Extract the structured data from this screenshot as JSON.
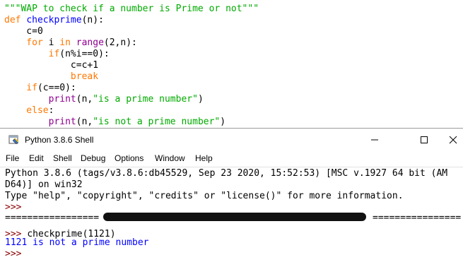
{
  "editor": {
    "lines": [
      {
        "parts": [
          {
            "c": "str",
            "t": "\"\"\"WAP to check if a number is Prime or not\"\"\""
          }
        ]
      },
      {
        "parts": [
          {
            "c": "kw",
            "t": "def "
          },
          {
            "c": "fn",
            "t": "checkprime"
          },
          {
            "c": "nm",
            "t": "(n):"
          }
        ]
      },
      {
        "parts": [
          {
            "c": "nm",
            "t": "    c=0"
          }
        ]
      },
      {
        "parts": [
          {
            "c": "kw",
            "t": "    for "
          },
          {
            "c": "nm",
            "t": "i "
          },
          {
            "c": "kw",
            "t": "in "
          },
          {
            "c": "bi",
            "t": "range"
          },
          {
            "c": "nm",
            "t": "(2,n):"
          }
        ]
      },
      {
        "parts": [
          {
            "c": "kw",
            "t": "        if"
          },
          {
            "c": "nm",
            "t": "(n%i==0):"
          }
        ]
      },
      {
        "parts": [
          {
            "c": "nm",
            "t": "            c=c+1"
          }
        ]
      },
      {
        "parts": [
          {
            "c": "kw",
            "t": "            break"
          }
        ]
      },
      {
        "parts": [
          {
            "c": "kw",
            "t": "    if"
          },
          {
            "c": "nm",
            "t": "(c==0):"
          }
        ]
      },
      {
        "parts": [
          {
            "c": "bi",
            "t": "        print"
          },
          {
            "c": "nm",
            "t": "(n,"
          },
          {
            "c": "str",
            "t": "\"is a prime number\""
          },
          {
            "c": "nm",
            "t": ")"
          }
        ]
      },
      {
        "parts": [
          {
            "c": "kw",
            "t": "    else"
          },
          {
            "c": "nm",
            "t": ":"
          }
        ]
      },
      {
        "parts": [
          {
            "c": "bi",
            "t": "        print"
          },
          {
            "c": "nm",
            "t": "(n,"
          },
          {
            "c": "str",
            "t": "\"is not a prime number\""
          },
          {
            "c": "nm",
            "t": ")"
          }
        ]
      }
    ]
  },
  "shell": {
    "title": "Python 3.8.6 Shell",
    "menu": [
      "File",
      "Edit",
      "Shell",
      "Debug",
      "Options",
      "Window",
      "Help"
    ],
    "banner_1": "Python 3.8.6 (tags/v3.8.6:db45529, Sep 23 2020, 15:52:53) [MSC v.1927 64 bit (AM",
    "banner_2": "D64)] on win32",
    "banner_3": "Type \"help\", \"copyright\", \"credits\" or \"license()\" for more information.",
    "prompt": ">>> ",
    "restart_left": "=================",
    "restart_right": "================",
    "command": "checkprime(1121)",
    "output": "1121 is not a prime number"
  }
}
